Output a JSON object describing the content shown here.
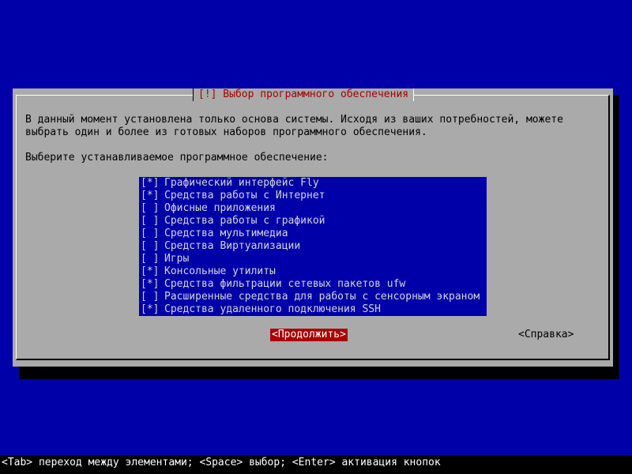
{
  "dialog": {
    "title": "[!] Выбор программного обеспечения",
    "description_line1": "В данный момент установлена только основа системы. Исходя из ваших потребностей, можете",
    "description_line2": "выбрать один и более из готовых наборов программного обеспечения.",
    "prompt": "Выберите устанавливаемое программное обеспечение:",
    "items": [
      {
        "mark": "[*]",
        "label": "Графический интерфейс Fly",
        "checked": true
      },
      {
        "mark": "[*]",
        "label": "Средства работы с Интернет",
        "checked": true
      },
      {
        "mark": "[ ]",
        "label": "Офисные приложения",
        "checked": false
      },
      {
        "mark": "[ ]",
        "label": "Средства работы с графикой",
        "checked": false
      },
      {
        "mark": "[ ]",
        "label": "Средства мультимедиа",
        "checked": false
      },
      {
        "mark": "[ ]",
        "label": "Средства Виртуализации",
        "checked": false
      },
      {
        "mark": "[ ]",
        "label": "Игры",
        "checked": false
      },
      {
        "mark": "[*]",
        "label": "Консольные утилиты",
        "checked": true
      },
      {
        "mark": "[*]",
        "label": "Средства фильтрации сетевых пакетов ufw",
        "checked": true
      },
      {
        "mark": "[ ]",
        "label": "Расширенные средства для работы с сенсорным экраном",
        "checked": false
      },
      {
        "mark": "[*]",
        "label": "Средства удаленного подключения SSH",
        "checked": true
      }
    ],
    "continue_button": "<Продолжить>",
    "help_button": "<Справка>"
  },
  "statusbar": {
    "hint": "<Tab> переход между элементами; <Space> выбор; <Enter> активация кнопок"
  },
  "colors": {
    "background": "#0000a8",
    "dialog": "#aaaaaa",
    "title_text": "#a80000",
    "focus_button": "#a80000"
  }
}
